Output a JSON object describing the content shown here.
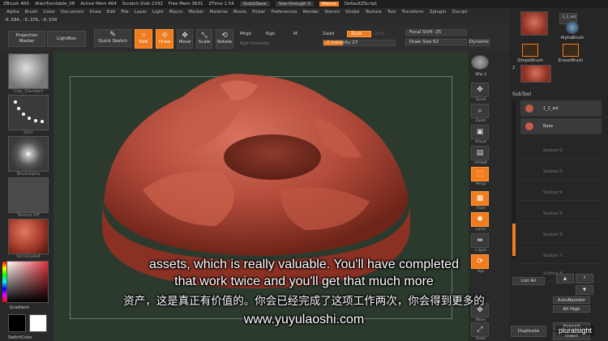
{
  "titlebar": {
    "items": [
      "ZBrush 4R5",
      "AlienTurntable_08",
      "Active Mem 464",
      "Scratch Disk 2192",
      "Free Mem 3631",
      "ZTime 1.54"
    ],
    "quicksave": "QuickSave",
    "seethrough": "See-through 0",
    "menus": "Menus",
    "script": "DefaultZScript"
  },
  "menubar": {
    "items": [
      "Alpha",
      "Brush",
      "Color",
      "Document",
      "Draw",
      "Edit",
      "File",
      "Layer",
      "Light",
      "Macro",
      "Marker",
      "Material",
      "Movie",
      "Picker",
      "Preferences",
      "Render",
      "Stencil",
      "Stroke",
      "Texture",
      "Tool",
      "Transform",
      "Zplugin",
      "Zscript"
    ]
  },
  "coords": "-0.594,-0.376,-0.534",
  "toolbar": {
    "projection_master": "Projection Master",
    "lightbox": "LightBox",
    "quick_sketch": "Quick Sketch",
    "edit": "Edit",
    "draw": "Draw",
    "move": "Move",
    "scale": "Scale",
    "rotate": "Rotate",
    "mrgb": "Mrgb",
    "rgb": "Rgb",
    "m": "M",
    "rgb_intensity": "Rgb Intensity",
    "zadd": "Zadd",
    "zsub": "Zsub",
    "zcut": "Zcut",
    "z_intensity": "Z Intensity 27",
    "focal_shift": "Focal Shift -25",
    "draw_size": "Draw Size 62",
    "dynamic": "Dynamic",
    "z_intensity_value": 27,
    "z_intensity_max": 100
  },
  "leftpanel": {
    "brush_label": "Clay_Standard",
    "stroke_label": "Dots",
    "alpha_label": "Brushalpha",
    "texture_label": "Texture Off",
    "material_label": "SkinShade4",
    "gradient": "Gradient",
    "switch_color": "SwitchColor"
  },
  "rightcol": {
    "spix": "SPix 3",
    "scroll": "Scroll",
    "zoom": "Zoom",
    "actual": "Actual",
    "aahalf": "AAHalf",
    "persp": "Persp",
    "floor": "Floor",
    "local": "Local",
    "lsym": "L.Sym",
    "xyz": "Xyz",
    "move": "Move",
    "scale": "Scale"
  },
  "farright": {
    "brushes": [
      "AlphaBrush",
      "SimpleBrush",
      "EraserBrush"
    ],
    "brush_counts": [
      "2",
      "1_2_ast"
    ],
    "subtool": "SubTool",
    "subtool_items": [
      "1_2_ast",
      "Base"
    ],
    "empty_slots": [
      "Subtool 2",
      "Subtool 3",
      "Subtool 4",
      "Subtool 5",
      "Subtool 6",
      "Subtool 7",
      "Subtool 8"
    ],
    "list_all": "List All",
    "auto_reorder": "AutoReorder",
    "all_high": "All High",
    "duplicate": "Duplicate",
    "append": "Append",
    "insert": "Insert"
  },
  "subtitles": {
    "en_line1": "assets, which is really valuable. You'll have completed",
    "en_line2": "that work twice and you'll get that much more",
    "cn_line": "资产，这是真正有价值的。你会已经完成了这项工作两次，你会得到更多的",
    "url": "www.yuyulaoshi.com"
  },
  "logo": "pluralsight",
  "colors": {
    "accent": "#f07c1e",
    "viewport_bg": "#2c3a2e",
    "model": "#b8473a"
  }
}
